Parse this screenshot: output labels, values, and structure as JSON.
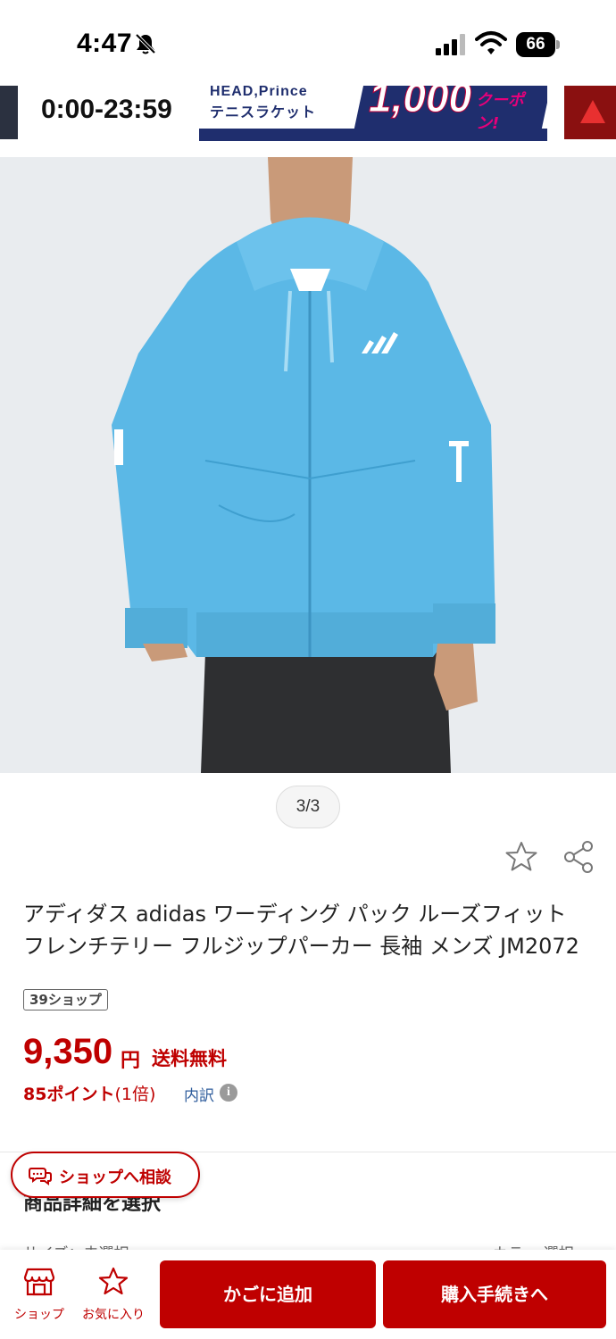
{
  "status_bar": {
    "time": "4:47",
    "battery": "66",
    "icons": [
      "bell-slash-icon",
      "cellular-signal-icon",
      "wifi-icon",
      "battery-icon"
    ]
  },
  "banner": {
    "campaign_time": "0:00-23:59",
    "ad_brands": "HEAD,Prince",
    "ad_category": "テニスラケット",
    "ad_amount": "1,000",
    "ad_coupon": "クーポン!"
  },
  "gallery": {
    "indicator": "3/3"
  },
  "product": {
    "title": "アディダス adidas ワーディング パック ルーズフィット フレンチテリー フルジップパーカー 長袖 メンズ JM2072",
    "shop_badge": "39ショップ",
    "price": "9,350",
    "price_unit": "円",
    "shipping": "送料無料",
    "points": "85ポイント",
    "points_rate": "(1倍)",
    "points_detail_link": "内訳"
  },
  "selection": {
    "heading": "商品詳細を選択",
    "size_label": "サイズ：未選択",
    "size_right": "カラー:選択"
  },
  "consult": {
    "label": "ショップへ相談"
  },
  "bottom_nav": {
    "shop_label": "ショップ",
    "fav_label": "お気に入り",
    "cart_label": "かごに追加",
    "buy_label": "購入手続きへ"
  },
  "colors": {
    "accent": "#bf0000",
    "link": "#2f5d9c",
    "hoodie": "#5bb8e6"
  }
}
